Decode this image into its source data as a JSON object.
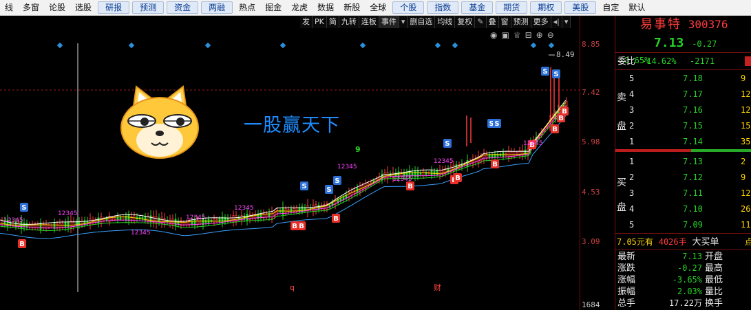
{
  "menu": {
    "items": [
      {
        "label": "线",
        "tab": false
      },
      {
        "label": "多窗",
        "tab": false
      },
      {
        "label": "论股",
        "tab": false
      },
      {
        "label": "选股",
        "tab": false
      },
      {
        "label": "研报",
        "tab": true
      },
      {
        "label": "预测",
        "tab": true
      },
      {
        "label": "资金",
        "tab": true
      },
      {
        "label": "两融",
        "tab": true
      },
      {
        "label": "热点",
        "tab": false
      },
      {
        "label": "掘金",
        "tab": false
      },
      {
        "label": "龙虎",
        "tab": false
      },
      {
        "label": "数据",
        "tab": false
      },
      {
        "label": "新股",
        "tab": false
      },
      {
        "label": "全球",
        "tab": false
      },
      {
        "label": "个股",
        "tab": true
      },
      {
        "label": "指数",
        "tab": true
      },
      {
        "label": "基金",
        "tab": true
      },
      {
        "label": "期货",
        "tab": true
      },
      {
        "label": "期权",
        "tab": true
      },
      {
        "label": "美股",
        "tab": true
      },
      {
        "label": "自定",
        "tab": false
      },
      {
        "label": "默认",
        "tab": false
      }
    ]
  },
  "toolbar": {
    "items": [
      {
        "label": "发",
        "icon": false
      },
      {
        "label": "PK",
        "icon": false
      },
      {
        "label": "简",
        "icon": false
      },
      {
        "label": "九转",
        "icon": false
      },
      {
        "label": "连板",
        "icon": false
      },
      {
        "label": "事件",
        "icon": false
      },
      {
        "label": "▾",
        "icon": true
      },
      {
        "label": "删自选",
        "icon": false
      },
      {
        "label": "均线",
        "icon": false
      },
      {
        "label": "复权",
        "icon": false
      },
      {
        "label": "叠",
        "icon": false
      },
      {
        "label": "窗",
        "icon": false
      },
      {
        "label": "预测",
        "icon": false
      },
      {
        "label": "更多",
        "icon": false
      },
      {
        "label": "◂|",
        "icon": true
      },
      {
        "label": "▾",
        "icon": true
      }
    ]
  },
  "slogan": "一股赢天下",
  "chart_labels": {
    "max_label": "8.49",
    "mark_q": "q",
    "mark_cai": "财",
    "nine": "9"
  },
  "axis": {
    "ticks": [
      "8.85",
      "7.42",
      "5.98",
      "4.53",
      "3.09",
      "1684"
    ]
  },
  "stock": {
    "name": "易事特",
    "code": "300376",
    "price": "7.13",
    "change": "-0.27",
    "pct": "-3.65%"
  },
  "weibi": {
    "label": "委比",
    "ratio": "-14.62%",
    "diff": "-2171"
  },
  "sell": {
    "label_a": "卖",
    "label_b": "盘",
    "rows": [
      {
        "lvl": "5",
        "price": "7.18",
        "vol": "9"
      },
      {
        "lvl": "4",
        "price": "7.17",
        "vol": "12"
      },
      {
        "lvl": "3",
        "price": "7.16",
        "vol": "12"
      },
      {
        "lvl": "2",
        "price": "7.15",
        "vol": "15"
      },
      {
        "lvl": "1",
        "price": "7.14",
        "vol": "35"
      }
    ]
  },
  "buy": {
    "label_a": "买",
    "label_b": "盘",
    "rows": [
      {
        "lvl": "1",
        "price": "7.13",
        "vol": "2"
      },
      {
        "lvl": "2",
        "price": "7.12",
        "vol": "9"
      },
      {
        "lvl": "3",
        "price": "7.11",
        "vol": "12"
      },
      {
        "lvl": "4",
        "price": "7.10",
        "vol": "26"
      },
      {
        "lvl": "5",
        "price": "7.09",
        "vol": "11"
      }
    ]
  },
  "bigorder": {
    "price": "7.05元有",
    "vol": "4026手",
    "label": "大买单",
    "tail": "点"
  },
  "quote": {
    "rows": [
      {
        "k": "最新",
        "v": "7.13",
        "k2": "开盘"
      },
      {
        "k": "涨跌",
        "v": "-0.27",
        "k2": "最高"
      },
      {
        "k": "涨幅",
        "v": "-3.65%",
        "k2": "最低"
      },
      {
        "k": "振幅",
        "v": "2.03%",
        "k2": "量比"
      },
      {
        "k": "总手",
        "v": "17.22万",
        "k2": "换手"
      }
    ]
  },
  "colors": {
    "up": "#ff3b3b",
    "down": "#27d127",
    "accent": "#1e8cff",
    "buy_badge": "#e8302a",
    "sell_badge": "#2c6fd6"
  }
}
